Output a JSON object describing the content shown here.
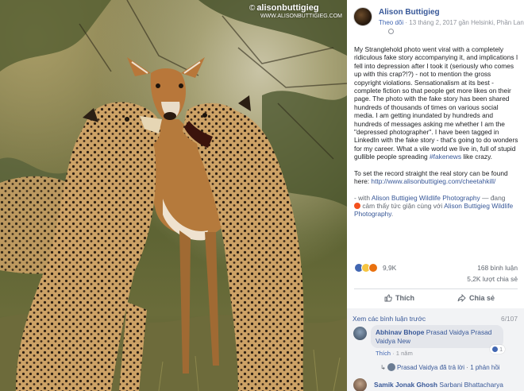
{
  "photo": {
    "alt": "Cheetahs and impala photograph",
    "watermark_copyright": "©",
    "watermark_name": "alisonbuttigieg",
    "watermark_url": "WWW.ALISONBUTTIGIEG.COM"
  },
  "post": {
    "author": "Alison Buttigieg",
    "follow_label": "Theo dõi",
    "meta_separator": " · ",
    "timestamp": "13 tháng 2, 2017 gần Helsinki, Phần Lan",
    "paragraph1": "My Stranglehold photo went viral with a completely ridiculous fake story accompanying it, and implications I fell into depression after I took it (seriously who comes up with this crap?!?) - not to mention the gross copyright violations. Sensationalism at its best - complete fiction so that people get more likes on their page. The photo with the fake story has been shared hundreds of thousands of times on various social media. I am getting inundated by hundreds and hundreds of messages asking me whether I am the \"depressed photographer\". I have been tagged in LinkedIn with the fake story - that's going to do wonders for my career. What a vile world we live in, full of stupid gullible people spreading ",
    "hashtag": "#fakenews",
    "paragraph1_end": " like crazy.",
    "paragraph2": "To set the record straight the real story can be found here: ",
    "story_link": "http://www.alisonbuttigieg.com/cheetahkill/",
    "with_prefix": "- with ",
    "with_page": "Alison Buttigieg Wildlife Photography",
    "feeling_text": " — đang ",
    "feeling_line2": " cảm thấy tức giận cùng với ",
    "feeling_page": "Alison Buttigieg Wildlife Photography",
    "feeling_end": "."
  },
  "stats": {
    "reactions_count": "9,9K",
    "comments_count": "168 bình luận",
    "shares_count": "5,2K lượt chia sẻ"
  },
  "actions": {
    "like_label": "Thích",
    "share_label": "Chia sẻ"
  },
  "comments": {
    "prev_label": "Xem các bình luận trước",
    "page_count": "6/107",
    "c1": {
      "name": "Abhinav Bhope",
      "tags": "Prasad Vaidya Prasad Vaidya New",
      "like_label": "Thích",
      "separator": " · ",
      "time": "1 năm",
      "like_count": "1"
    },
    "reply": {
      "arrow": "↳",
      "name": "Prasad Vaidya",
      "text": " đã trả lời",
      "separator": " · ",
      "count": "1 phản hồi"
    },
    "c2": {
      "name": "Samik Jonak Ghosh",
      "tags": "Sarbani Bhattacharya"
    }
  },
  "colors": {
    "link": "#385898",
    "accent": "#4267b2",
    "muted": "#90949c"
  }
}
